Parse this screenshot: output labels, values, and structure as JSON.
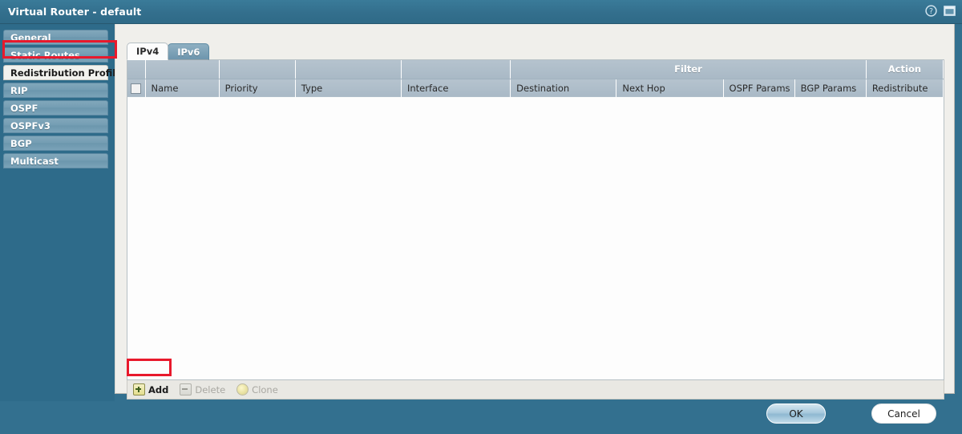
{
  "window": {
    "title": "Virtual Router - default",
    "help_icon": "help-circle-icon",
    "restore_icon": "window-restore-icon"
  },
  "sidebar": {
    "items": [
      {
        "label": "General",
        "selected": false
      },
      {
        "label": "Static Routes",
        "selected": false
      },
      {
        "label": "Redistribution Profile",
        "selected": true
      },
      {
        "label": "RIP",
        "selected": false
      },
      {
        "label": "OSPF",
        "selected": false
      },
      {
        "label": "OSPFv3",
        "selected": false
      },
      {
        "label": "BGP",
        "selected": false
      },
      {
        "label": "Multicast",
        "selected": false
      }
    ]
  },
  "tabs": [
    {
      "label": "IPv4",
      "active": true
    },
    {
      "label": "IPv6",
      "active": false
    }
  ],
  "table": {
    "group_headers": [
      {
        "label": "",
        "span": 1,
        "kind": "blank"
      },
      {
        "label": "",
        "span": 1,
        "kind": "blank"
      },
      {
        "label": "",
        "span": 1,
        "kind": "blank"
      },
      {
        "label": "",
        "span": 1,
        "kind": "blank"
      },
      {
        "label": "Filter",
        "span": 4,
        "kind": "group"
      },
      {
        "label": "Action",
        "span": 1,
        "kind": "group"
      }
    ],
    "columns": [
      "Name",
      "Priority",
      "Type",
      "Interface",
      "Destination",
      "Next Hop",
      "OSPF Params",
      "BGP Params",
      "Redistribute"
    ],
    "rows": [],
    "select_all_checked": false
  },
  "toolbar": {
    "add": {
      "label": "Add",
      "icon": "plus-icon",
      "enabled": true
    },
    "delete": {
      "label": "Delete",
      "icon": "minus-icon",
      "enabled": false
    },
    "clone": {
      "label": "Clone",
      "icon": "clone-circle-icon",
      "enabled": false
    }
  },
  "footer": {
    "ok": "OK",
    "cancel": "Cancel"
  },
  "highlights": {
    "color": "#e8192c",
    "targets": [
      "sidebar-item-redistribution-profile",
      "add-button"
    ]
  }
}
